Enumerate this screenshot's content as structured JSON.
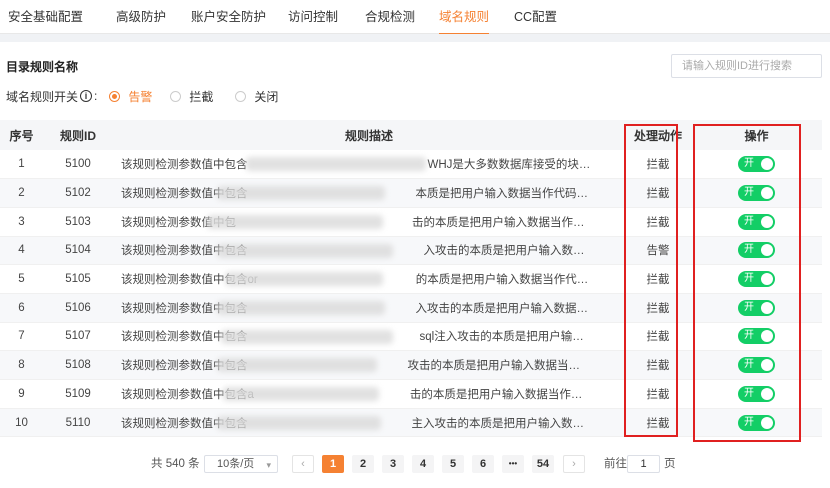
{
  "tabs": [
    {
      "label": "安全基础配置",
      "active": false
    },
    {
      "label": "高级防护",
      "active": false
    },
    {
      "label": "账户安全防护",
      "active": false
    },
    {
      "label": "访问控制",
      "active": false
    },
    {
      "label": "合规检测",
      "active": false
    },
    {
      "label": "域名规则",
      "active": true
    },
    {
      "label": "CC配置",
      "active": false
    }
  ],
  "section": {
    "title": "目录规则名称"
  },
  "search": {
    "placeholder": "请输入规则ID进行搜索",
    "value": ""
  },
  "rule_switch": {
    "label": "域名规则开关",
    "info_icon": "i",
    "colon": ":",
    "options": [
      {
        "label": "告警",
        "selected": true
      },
      {
        "label": "拦截",
        "selected": false
      },
      {
        "label": "关闭",
        "selected": false
      }
    ]
  },
  "table": {
    "headers": {
      "no": "序号",
      "id": "规则ID",
      "desc": "规则描述",
      "action": "处理动作",
      "op": "操作"
    },
    "rows": [
      {
        "no": "1",
        "id": "5100",
        "desc": "该规则检测参数值中包含",
        "desc_tail": "WHJ是大多数数据库接受的块注释方式，在攻击者构造SQL注…",
        "action": "拦截",
        "toggle": "开"
      },
      {
        "no": "2",
        "id": "5102",
        "desc": "该规则检测参数值中包含",
        "desc_tail": "本质是把用户输入数据当作代码执行了…",
        "action": "拦截",
        "toggle": "开"
      },
      {
        "no": "3",
        "id": "5103",
        "desc": "该规则检测参数值中包",
        "desc_tail": "击的本质是把用户输入数据当作代码执行了…",
        "action": "拦截",
        "toggle": "开"
      },
      {
        "no": "4",
        "id": "5104",
        "desc": "该规则检测参数值中包含",
        "desc_tail": "入攻击的本质是把用户输入数据当作代码执行了…",
        "action": "告警",
        "toggle": "开"
      },
      {
        "no": "5",
        "id": "5105",
        "desc": "该规则检测参数值中包含or",
        "desc_tail": "的本质是把用户输入数据当作代码执行…",
        "action": "拦截",
        "toggle": "开"
      },
      {
        "no": "6",
        "id": "5106",
        "desc": "该规则检测参数值中包含",
        "desc_tail": "入攻击的本质是把用户输入数据当作代码执行了…",
        "action": "拦截",
        "toggle": "开"
      },
      {
        "no": "7",
        "id": "5107",
        "desc": "该规则检测参数值中包含",
        "desc_tail": "sql注入攻击的本质是把用户输入数据当作代码…",
        "action": "拦截",
        "toggle": "开"
      },
      {
        "no": "8",
        "id": "5108",
        "desc": "该规则检测参数值中包含",
        "desc_tail": "攻击的本质是把用户输入数据当作代码执行…",
        "action": "拦截",
        "toggle": "开"
      },
      {
        "no": "9",
        "id": "5109",
        "desc": "该规则检测参数值中包含a",
        "desc_tail": "击的本质是把用户输入数据当作代码执行…",
        "action": "拦截",
        "toggle": "开"
      },
      {
        "no": "10",
        "id": "5110",
        "desc": "该规则检测参数值中包含",
        "desc_tail": "主入攻击的本质是把用户输入数据当作代码执行…",
        "action": "拦截",
        "toggle": "开"
      }
    ]
  },
  "pagination": {
    "total": "共 540 条",
    "page_size": "10条/页",
    "prev": "‹",
    "pages": [
      "1",
      "2",
      "3",
      "4",
      "5",
      "6",
      "•••",
      "54"
    ],
    "next": "›",
    "goto_label": "前往",
    "goto_value": "1",
    "goto_suffix": "页"
  }
}
